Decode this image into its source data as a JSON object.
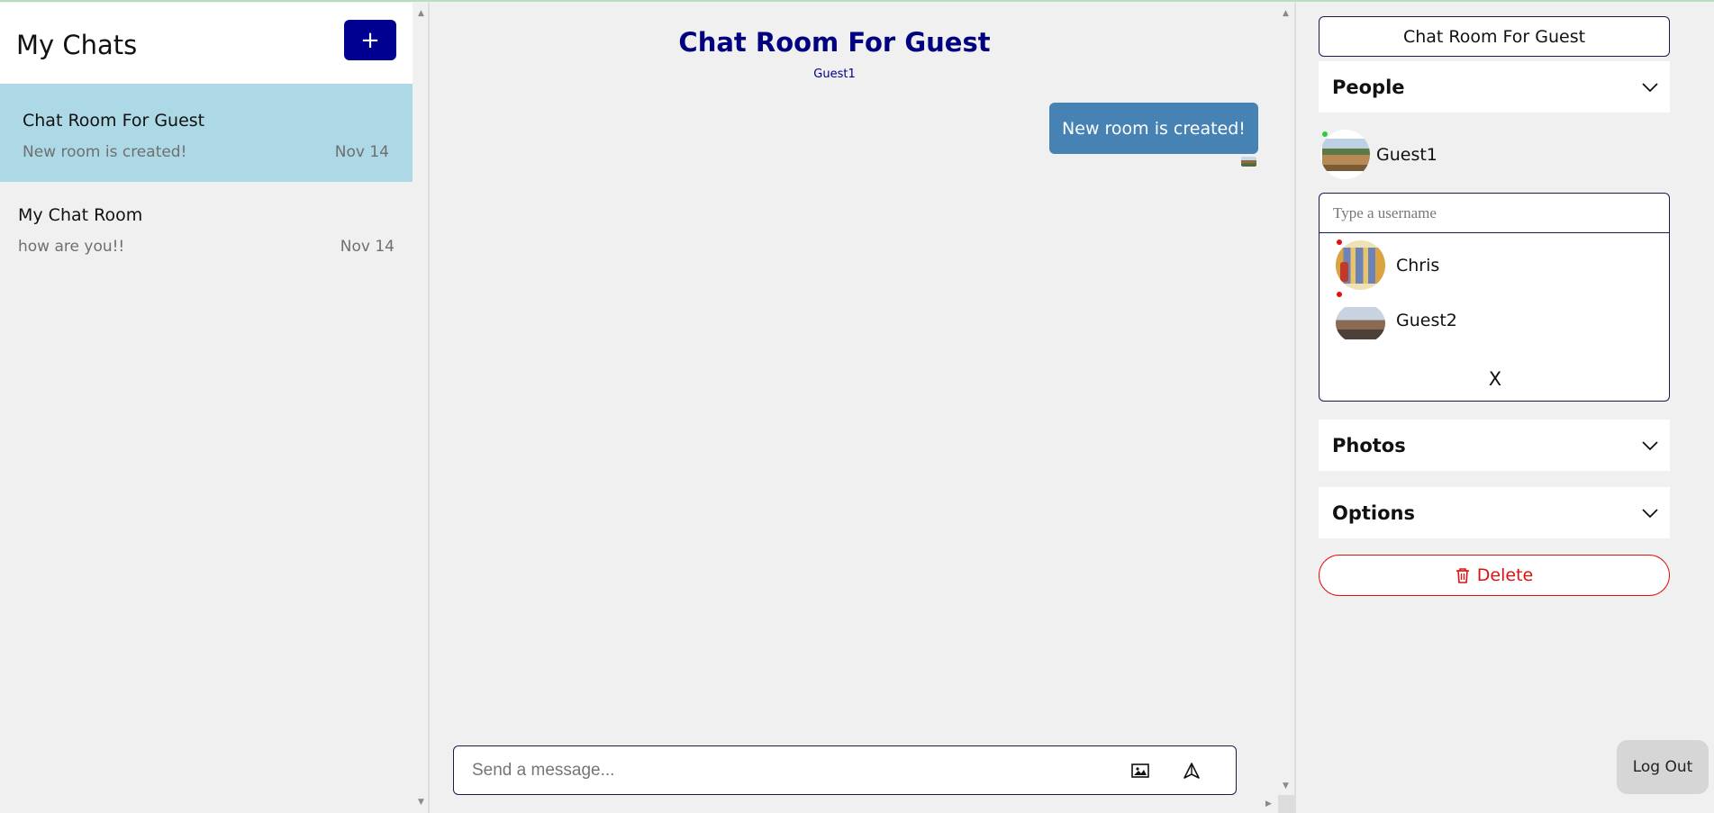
{
  "sidebar": {
    "title": "My Chats",
    "add_label": "+",
    "chats": [
      {
        "title": "Chat Room For Guest",
        "preview": "New room is created!",
        "date": "Nov 14"
      },
      {
        "title": "My Chat Room",
        "preview": "how are you!!",
        "date": "Nov 14"
      }
    ]
  },
  "chat": {
    "room_title": "Chat Room For Guest",
    "subtitle": "Guest1",
    "messages": [
      {
        "text": "New room is created!"
      }
    ],
    "composer": {
      "placeholder": "Send a message..."
    },
    "icons": {
      "attach": "image-icon",
      "send": "send-icon"
    }
  },
  "details": {
    "room_name": "Chat Room For Guest",
    "people_label": "People",
    "members": [
      {
        "name": "Guest1",
        "status": "online",
        "status_color": "#2ecc40"
      }
    ],
    "search": {
      "placeholder": "Type a username"
    },
    "results": [
      {
        "name": "Chris",
        "status_color": "#e01010"
      },
      {
        "name": "Guest2",
        "status_color": "#e01010"
      }
    ],
    "close_label": "X",
    "photos_label": "Photos",
    "options_label": "Options",
    "delete_label": "Delete",
    "logout_label": "Log Out"
  },
  "colors": {
    "accent": "#000090",
    "title_navy": "#000080",
    "active_chat": "#add8e6",
    "bubble": "#4682b4",
    "danger": "#e01010"
  }
}
